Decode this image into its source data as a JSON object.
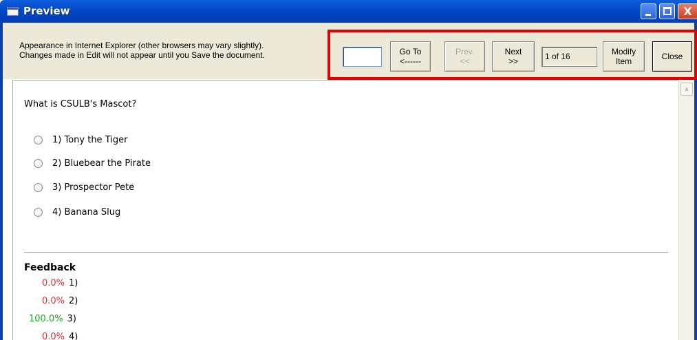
{
  "window": {
    "title": "Preview",
    "controls": {
      "minimize": "_",
      "maximize": "□",
      "close": "X"
    }
  },
  "info": {
    "line1": "Appearance in Internet Explorer (other browsers may vary slightly).",
    "line2": "Changes made in Edit will not appear until you Save the document."
  },
  "nav": {
    "goto_input_value": "",
    "goto_label_line1": "Go To",
    "goto_label_line2": "<------",
    "prev_line1": "Prev.",
    "prev_line2": "<<",
    "next_line1": "Next",
    "next_line2": ">>",
    "counter": "1 of 16",
    "modify_line1": "Modify",
    "modify_line2": "Item",
    "close_label": "Close"
  },
  "question": {
    "text": "What is CSULB's Mascot?",
    "options": [
      {
        "label": "1) Tony the Tiger"
      },
      {
        "label": "2) Bluebear the Pirate"
      },
      {
        "label": "3) Prospector Pete"
      },
      {
        "label": "4) Banana Slug"
      }
    ]
  },
  "feedback": {
    "title": "Feedback",
    "rows": [
      {
        "pct": "0.0%",
        "num": "1)",
        "color": "#e03030"
      },
      {
        "pct": "0.0%",
        "num": "2)",
        "color": "#e03030"
      },
      {
        "pct": "100.0%",
        "num": "3)",
        "color": "#1ea11e"
      },
      {
        "pct": "0.0%",
        "num": "4)",
        "color": "#e03030"
      }
    ]
  },
  "colors": {
    "highlight_box": "#e00000",
    "titlebar": "#0047c4",
    "toolbar_bg": "#ece9d8"
  }
}
